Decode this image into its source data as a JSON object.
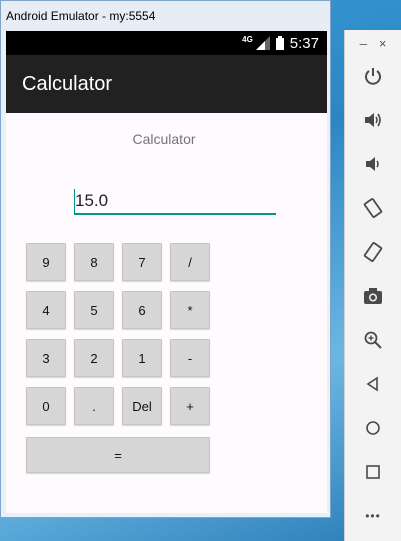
{
  "window": {
    "title": "Android Emulator - my:5554"
  },
  "status_bar": {
    "network": "4G",
    "time": "5:37"
  },
  "app_bar": {
    "title": "Calculator"
  },
  "content": {
    "label": "Calculator",
    "display_value": "15.0"
  },
  "keypad": {
    "rows": [
      [
        "9",
        "8",
        "7",
        "/"
      ],
      [
        "4",
        "5",
        "6",
        "*"
      ],
      [
        "3",
        "2",
        "1",
        "-"
      ],
      [
        "0",
        ".",
        "Del",
        "+"
      ]
    ],
    "equals": "="
  },
  "toolbar": {
    "minimize": "–",
    "close": "×",
    "icons": [
      "power-icon",
      "volume-up-icon",
      "volume-down-icon",
      "rotate-left-icon",
      "rotate-right-icon",
      "camera-icon",
      "zoom-icon",
      "back-icon",
      "home-icon",
      "overview-icon",
      "more-icon"
    ],
    "more": "•••"
  }
}
